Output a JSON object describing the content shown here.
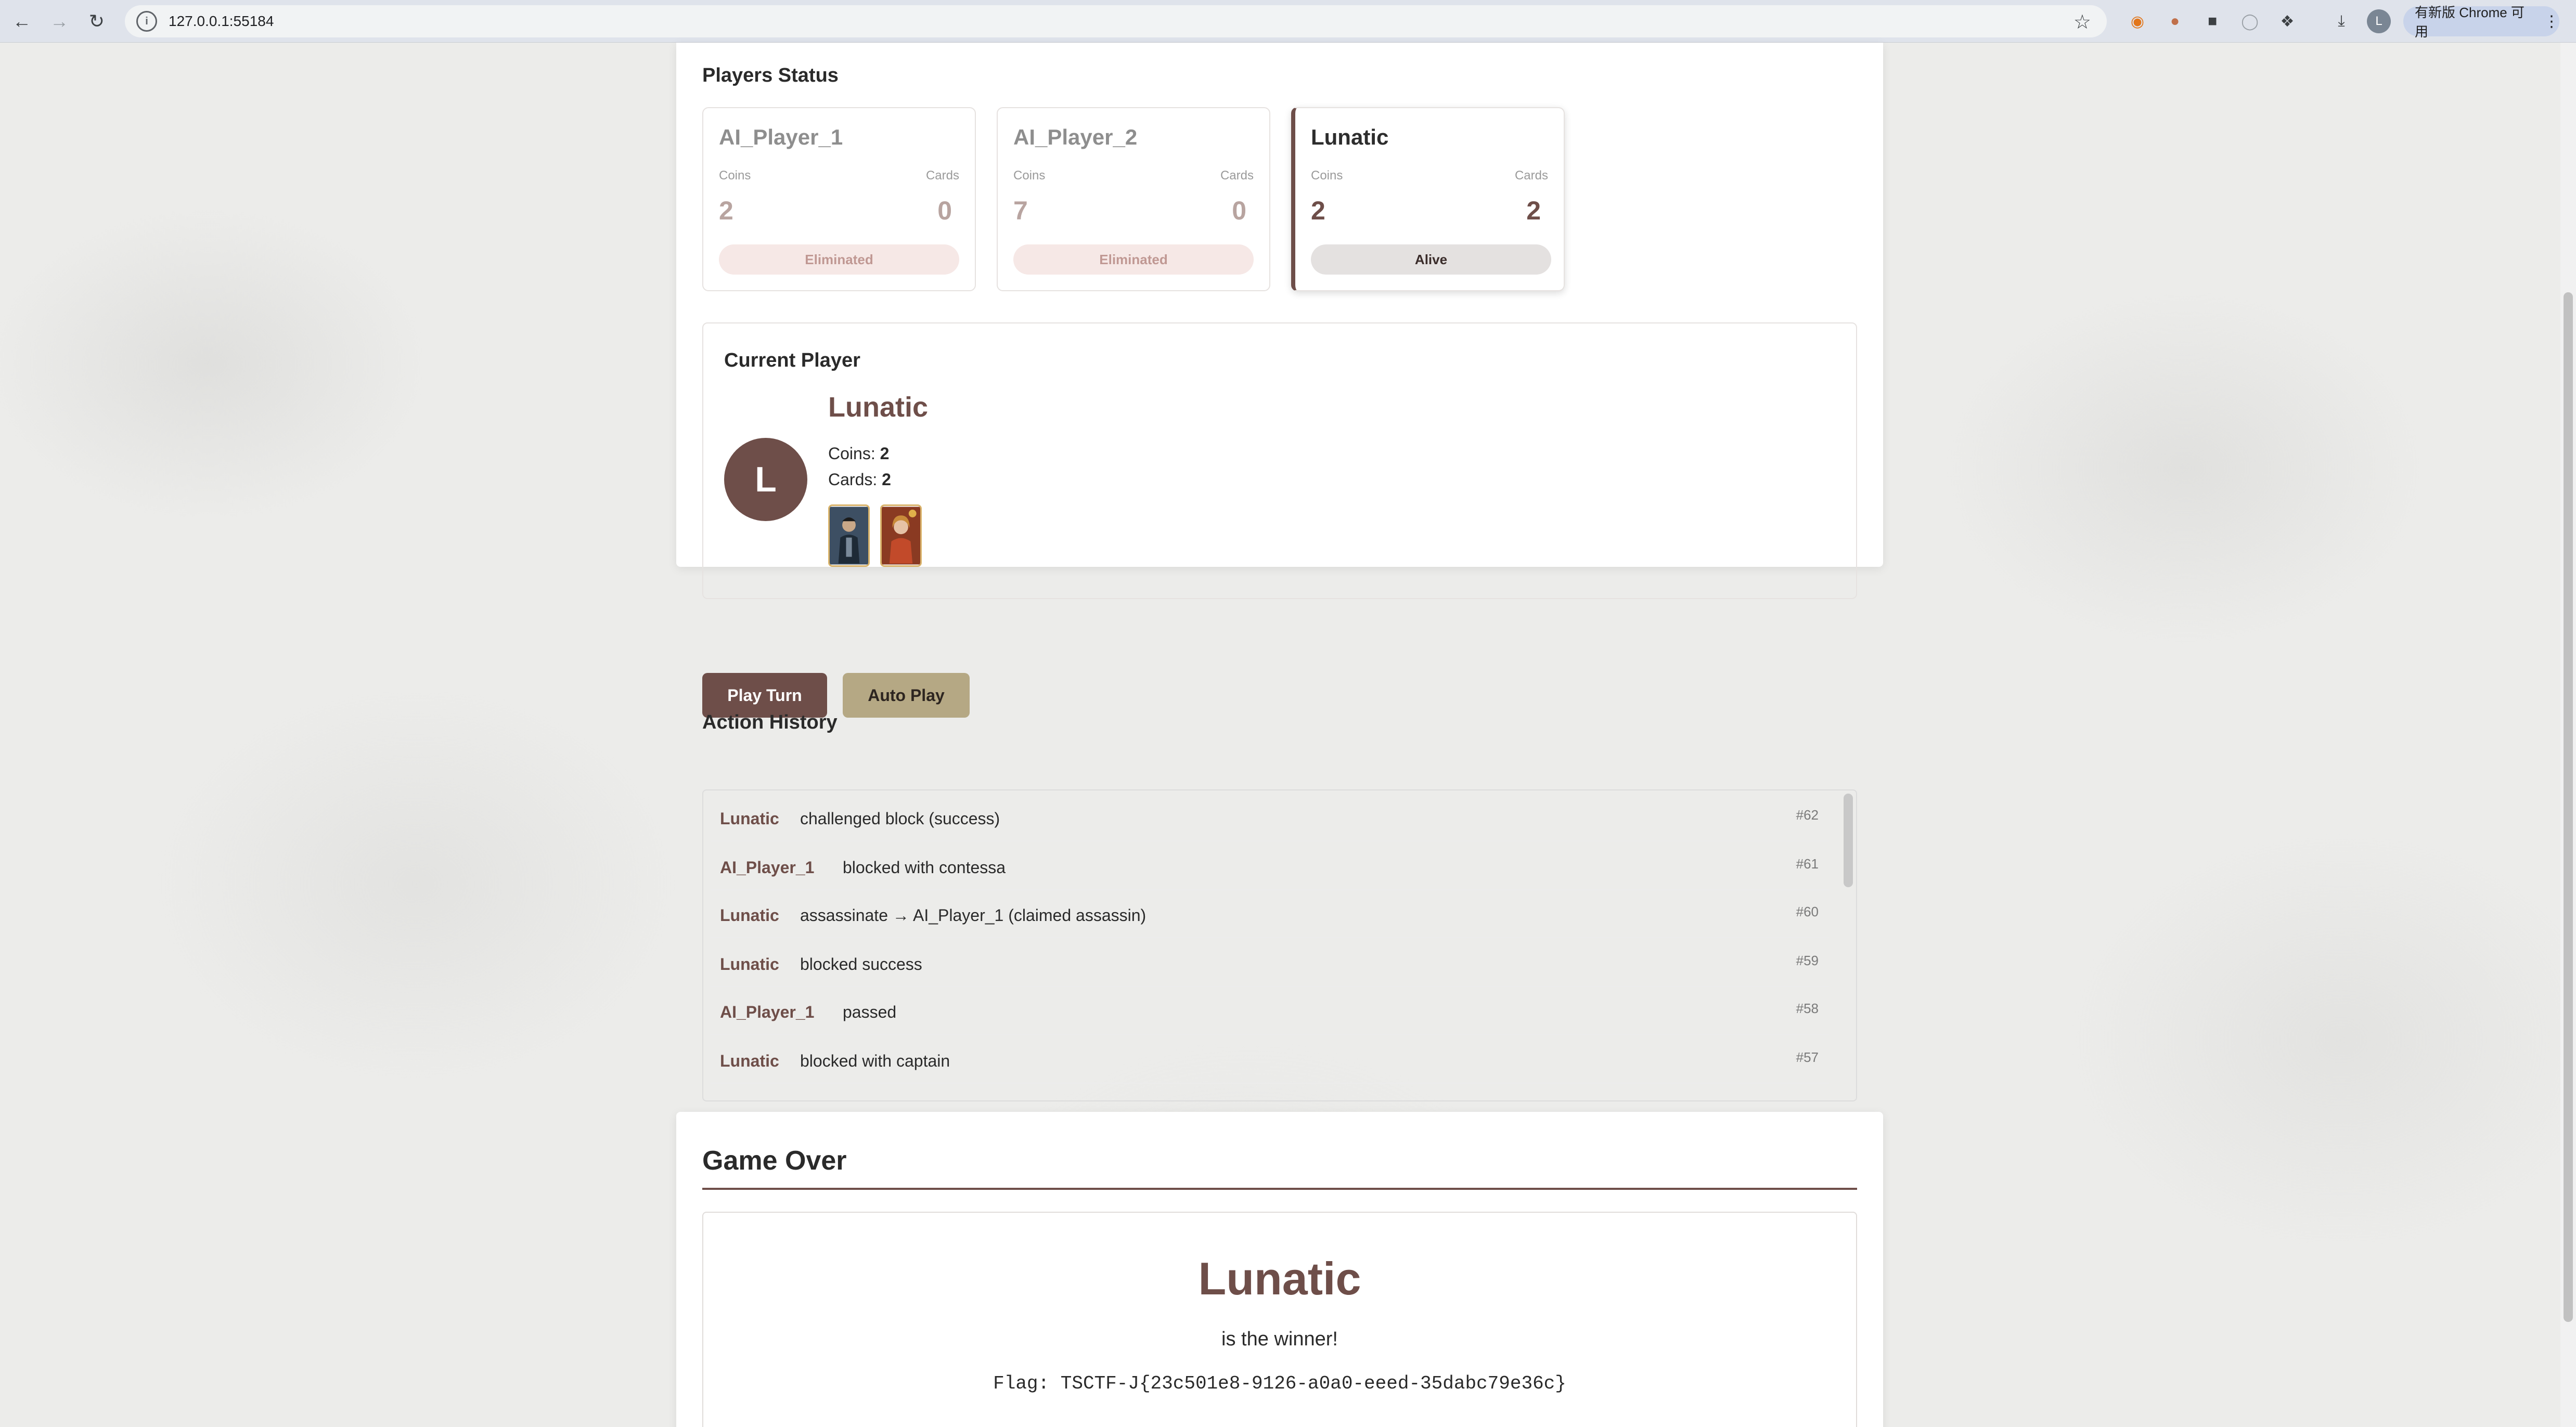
{
  "browser": {
    "url": "127.0.0.1:55184",
    "update_label": "有新版 Chrome 可用",
    "profile_initial": "L"
  },
  "players_status": {
    "title": "Players Status",
    "coins_label": "Coins",
    "cards_label": "Cards",
    "players": [
      {
        "name": "AI_Player_1",
        "coins": "2",
        "cards": "0",
        "status": "Eliminated"
      },
      {
        "name": "AI_Player_2",
        "coins": "7",
        "cards": "0",
        "status": "Eliminated"
      },
      {
        "name": "Lunatic",
        "coins": "2",
        "cards": "2",
        "status": "Alive"
      }
    ]
  },
  "current_player": {
    "title": "Current Player",
    "initial": "L",
    "name": "Lunatic",
    "coins_label": "Coins:",
    "coins": "2",
    "cards_label": "Cards:",
    "cards": "2",
    "card_images": [
      "captain-card",
      "contessa-card"
    ]
  },
  "buttons": {
    "play_turn": "Play Turn",
    "auto_play": "Auto Play"
  },
  "action_history": {
    "title": "Action History",
    "rows": [
      {
        "actor": "Lunatic",
        "text": "challenged block (success)",
        "num": "#62"
      },
      {
        "actor": "AI_Player_1",
        "text": "blocked with contessa",
        "num": "#61"
      },
      {
        "actor": "Lunatic",
        "text": "assassinate → AI_Player_1 (claimed assassin)",
        "num": "#60"
      },
      {
        "actor": "Lunatic",
        "text": "blocked success",
        "num": "#59"
      },
      {
        "actor": "AI_Player_1",
        "text": "passed",
        "num": "#58"
      },
      {
        "actor": "Lunatic",
        "text": "blocked with captain",
        "num": "#57"
      }
    ]
  },
  "game_over": {
    "title": "Game Over",
    "winner": "Lunatic",
    "winner_text": "is the winner!",
    "flag": "Flag: TSCTF-J{23c501e8-9126-a0a0-eeed-35dabc79e36c}"
  },
  "colors": {
    "accent": "#6e4e49",
    "auto_button": "#b5a884",
    "eliminated_bg": "#f6e8e6"
  }
}
